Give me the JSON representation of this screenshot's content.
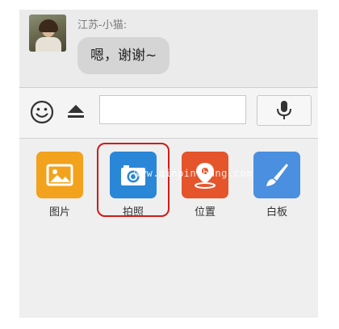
{
  "chat": {
    "sender_name": "江苏-小猫:",
    "message_text": "嗯，谢谢~"
  },
  "input_bar": {
    "text_value": "",
    "emoji_icon": "smiley-face-icon",
    "keyboard_icon": "eject-triangle-icon",
    "voice_icon": "microphone-icon"
  },
  "attachments": {
    "items": [
      {
        "label": "图片",
        "icon": "image-picture-icon",
        "color": "#f2a21c"
      },
      {
        "label": "拍照",
        "icon": "camera-icon",
        "color": "#2a86d6"
      },
      {
        "label": "位置",
        "icon": "location-pin-icon",
        "color": "#e5542b"
      },
      {
        "label": "白板",
        "icon": "whiteboard-brush-icon",
        "color": "#4a8fe0"
      }
    ],
    "highlighted_item": "拍照",
    "highlight_color": "#d21a1a"
  },
  "watermark": "www.qinpinchang.com"
}
